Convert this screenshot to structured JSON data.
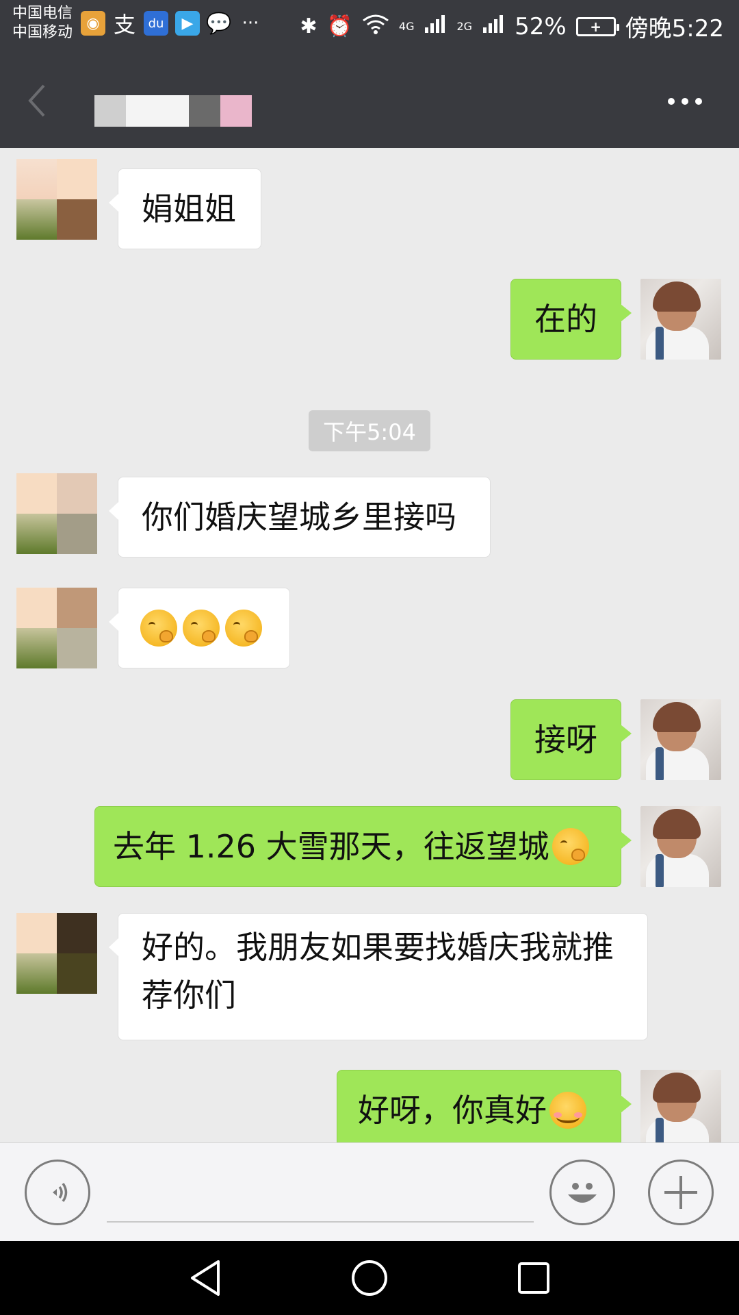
{
  "status_bar": {
    "carrier_1": "中国电信",
    "carrier_2": "中国移动",
    "notification_icons": [
      "weibo-icon",
      "alipay-icon",
      "baidu-icon",
      "video-app-icon",
      "chat-bubble-icon",
      "more-icon"
    ],
    "network_1": "4G",
    "network_2": "2G",
    "battery_percent": "52%",
    "time": "傍晚5:22"
  },
  "header": {
    "back_icon": "back-arrow-icon",
    "more_icon": "more-dots-icon"
  },
  "messages": [
    {
      "side": "left",
      "text": "娟姐姐"
    },
    {
      "side": "right",
      "text": "在的"
    },
    {
      "type": "time",
      "text": "下午5:04"
    },
    {
      "side": "left",
      "text": "你们婚庆望城乡里接吗"
    },
    {
      "side": "left",
      "emoji": [
        "thinking-face",
        "thinking-face",
        "thinking-face"
      ]
    },
    {
      "side": "right",
      "text": "接呀"
    },
    {
      "side": "right",
      "text": "去年 1.26 大雪那天，往返望城",
      "emoji_suffix": "thinking-face"
    },
    {
      "side": "left",
      "text": "好的。我朋友如果要找婚庆我就推荐你们"
    },
    {
      "side": "right",
      "text": "好呀，你真好",
      "emoji_suffix": "smiling-face"
    }
  ],
  "input_bar": {
    "voice_icon": "voice-icon",
    "emoji_icon": "emoji-icon",
    "add_icon": "plus-icon",
    "input_value": ""
  },
  "colors": {
    "topbar": "#393a3f",
    "chat_bg": "#ebebeb",
    "bubble_self": "#9fe658",
    "bubble_other": "#ffffff"
  }
}
